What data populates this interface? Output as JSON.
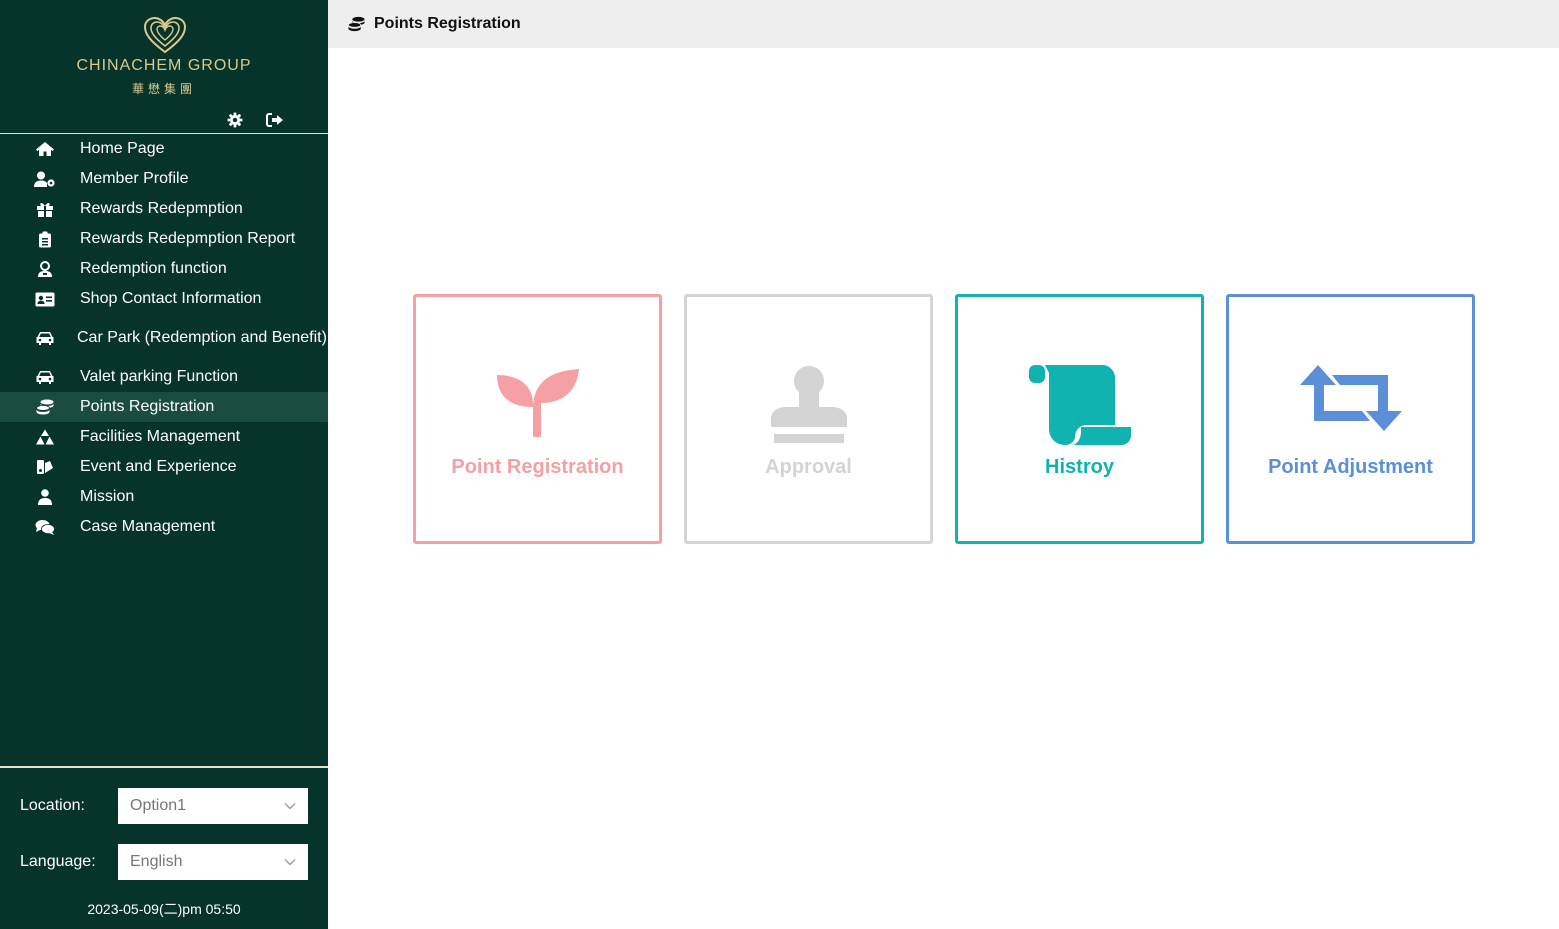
{
  "brand": {
    "name": "CHINACHEM GROUP",
    "name_cn": "華懋集團",
    "color": "#d8c98f"
  },
  "sidebar": {
    "background": "#06332a",
    "items": [
      {
        "label": "Home Page",
        "icon": "home-icon"
      },
      {
        "label": "Member Profile",
        "icon": "user-cog-icon"
      },
      {
        "label": "Rewards Redepmption",
        "icon": "gift-icon"
      },
      {
        "label": "Rewards Redepmption Report",
        "icon": "clipboard-icon"
      },
      {
        "label": "Redemption function",
        "icon": "user-badge-icon"
      },
      {
        "label": "Shop Contact Information",
        "icon": "id-card-icon"
      },
      {
        "label": "Car Park (Redemption and Benefit)",
        "icon": "car-icon"
      },
      {
        "label": "Valet parking Function",
        "icon": "car-icon"
      },
      {
        "label": "Points Registration",
        "icon": "coins-icon",
        "active": true
      },
      {
        "label": "Facilities Management",
        "icon": "sitemap-icon"
      },
      {
        "label": "Event and Experience",
        "icon": "palette-icon"
      },
      {
        "label": "Mission",
        "icon": "user-icon"
      },
      {
        "label": "Case Management",
        "icon": "comments-icon"
      }
    ]
  },
  "bottom": {
    "location_label": "Location:",
    "location_value": "Option1",
    "language_label": "Language:",
    "language_value": "English",
    "datetime": "2023-05-09(二)pm 05:50"
  },
  "header": {
    "title": "Points Registration",
    "icon": "coins-icon"
  },
  "cards": [
    {
      "label": "Point Registration",
      "icon": "seedling-icon",
      "color": "#f4a0a4"
    },
    {
      "label": "Approval",
      "icon": "stamp-icon",
      "color": "#d4d4d4"
    },
    {
      "label": "Histroy",
      "icon": "scroll-icon",
      "color": "#11b3b0"
    },
    {
      "label": "Point Adjustment",
      "icon": "retweet-icon",
      "color": "#5b8fd8"
    }
  ]
}
